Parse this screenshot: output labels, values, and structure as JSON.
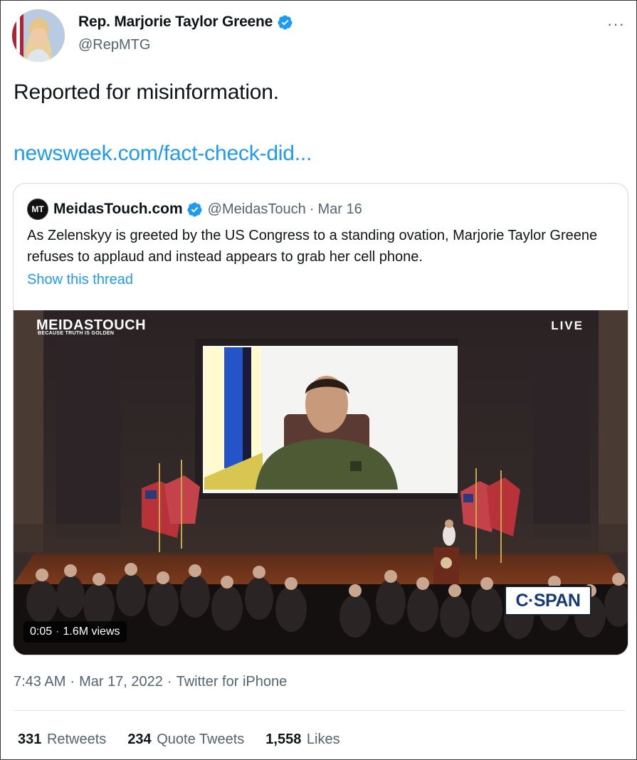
{
  "author": {
    "name": "Rep. Marjorie Taylor Greene",
    "handle": "@RepMTG",
    "verified_icon": "verified-badge-icon",
    "more_label": "···"
  },
  "tweet": {
    "text": "Reported for misinformation.",
    "link": "newsweek.com/fact-check-did..."
  },
  "quoted": {
    "avatar_text": "MT",
    "name": "MeidasTouch.com",
    "handle": "@MeidasTouch",
    "separator": "·",
    "date": "Mar 16",
    "text": "As Zelenskyy is greeted by the US Congress to a standing ovation, Marjorie Taylor Greene refuses to applaud and instead appears to grab her cell phone.",
    "show_thread": "Show this thread",
    "video": {
      "watermark_title": "MEIDASTOUCH",
      "watermark_sub": "BECAUSE TRUTH IS GOLDEN",
      "live_label": "LIVE",
      "broadcaster": "C·SPAN",
      "duration": "0:05",
      "views": "1.6M views"
    }
  },
  "meta": {
    "time": "7:43 AM",
    "date": "Mar 17, 2022",
    "source": "Twitter for iPhone",
    "separator": "·"
  },
  "stats": {
    "retweets_count": "331",
    "retweets_label": "Retweets",
    "quotes_count": "234",
    "quotes_label": "Quote Tweets",
    "likes_count": "1,558",
    "likes_label": "Likes"
  },
  "colors": {
    "link": "#1d9bf0",
    "secondary_text": "#536471",
    "primary_text": "#0f1419",
    "verified": "#1d9bf0"
  }
}
